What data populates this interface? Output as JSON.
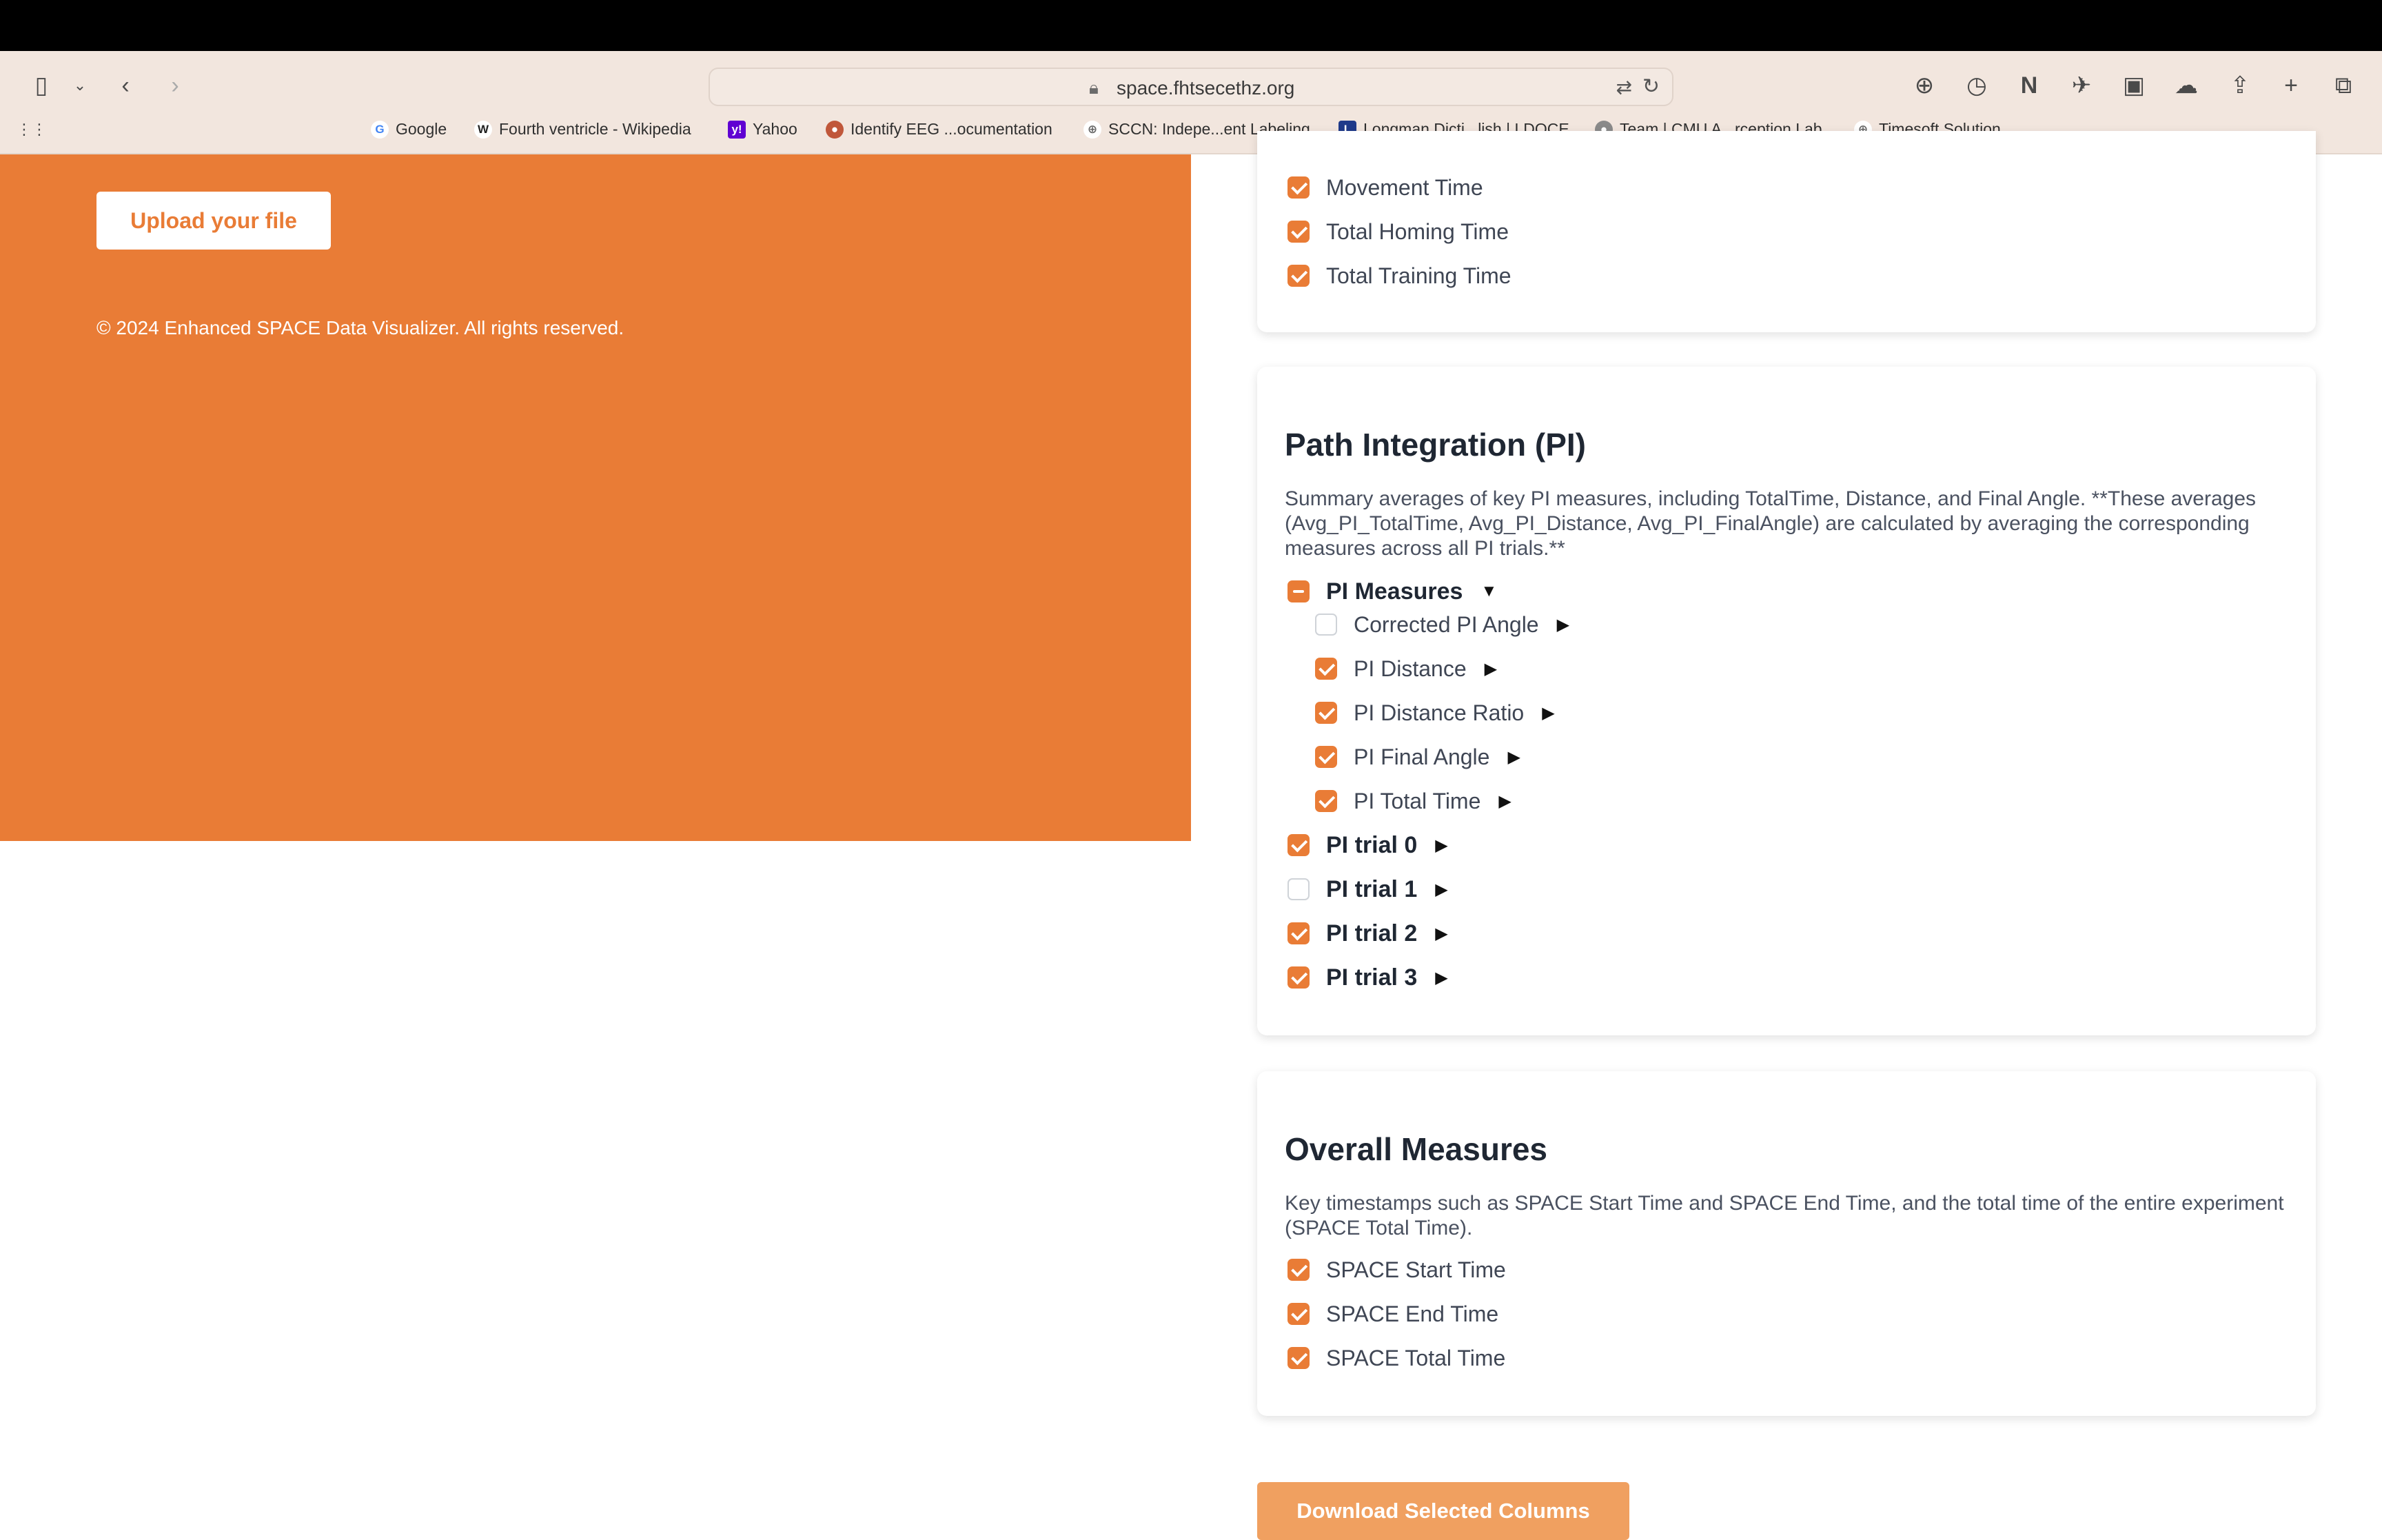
{
  "browser": {
    "url": "space.fhtsecethz.org",
    "bookmarks": [
      {
        "label": "Google",
        "icon": "google-icon"
      },
      {
        "label": "Fourth ventricle - Wikipedia",
        "icon": "wikipedia-icon"
      },
      {
        "label": "Yahoo",
        "icon": "yahoo-icon"
      },
      {
        "label": "Identify EEG ...ocumentation",
        "icon": "eeg-icon"
      },
      {
        "label": "SCCN: Indepe...ent Labeling",
        "icon": "globe-icon"
      },
      {
        "label": "Longman Dicti...lish | LDOCE",
        "icon": "longman-icon"
      },
      {
        "label": "Team | CMU A...rception Lab",
        "icon": "cmu-icon"
      },
      {
        "label": "Timesoft Solution",
        "icon": "globe-icon"
      }
    ]
  },
  "left_panel": {
    "upload_label": "Upload your file",
    "copyright": "© 2024 Enhanced SPACE Data Visualizer. All rights reserved.",
    "accent": "#e97c36"
  },
  "top_card": {
    "items": [
      {
        "label": "Movement Time",
        "checked": true
      },
      {
        "label": "Total Homing Time",
        "checked": true
      },
      {
        "label": "Total Training Time",
        "checked": true
      }
    ]
  },
  "pi_card": {
    "title": "Path Integration (PI)",
    "description": "Summary averages of key PI measures, including TotalTime, Distance, and Final Angle. **These averages (Avg_PI_TotalTime, Avg_PI_Distance, Avg_PI_FinalAngle) are calculated by averaging the corresponding measures across all PI trials.**",
    "group_label": "PI Measures",
    "group_state": "mixed",
    "measures": [
      {
        "label": "Corrected PI Angle",
        "checked": false
      },
      {
        "label": "PI Distance",
        "checked": true
      },
      {
        "label": "PI Distance Ratio",
        "checked": true
      },
      {
        "label": "PI Final Angle",
        "checked": true
      },
      {
        "label": "PI Total Time",
        "checked": true
      }
    ],
    "trials": [
      {
        "label": "PI trial 0",
        "checked": true
      },
      {
        "label": "PI trial 1",
        "checked": false
      },
      {
        "label": "PI trial 2",
        "checked": true
      },
      {
        "label": "PI trial 3",
        "checked": true
      }
    ]
  },
  "overall_card": {
    "title": "Overall Measures",
    "description": "Key timestamps such as SPACE Start Time and SPACE End Time, and the total time of the entire experiment (SPACE Total Time).",
    "items": [
      {
        "label": "SPACE Start Time",
        "checked": true
      },
      {
        "label": "SPACE End Time",
        "checked": true
      },
      {
        "label": "SPACE Total Time",
        "checked": true
      }
    ]
  },
  "download_label": "Download Selected Columns",
  "tri_closed": "▶",
  "tri_open": "▼"
}
